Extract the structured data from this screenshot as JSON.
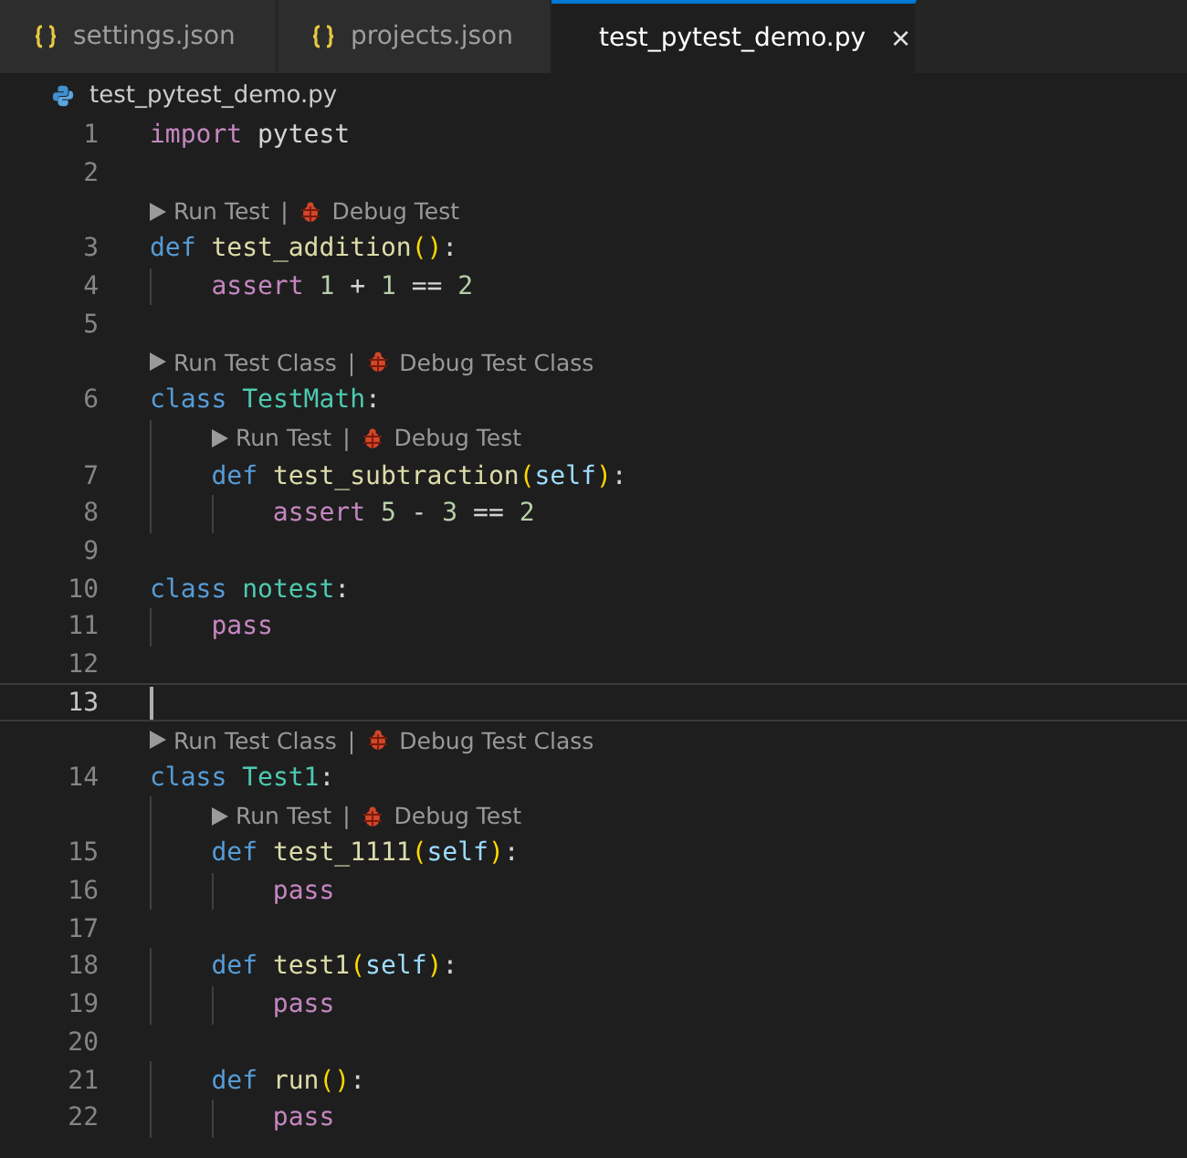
{
  "tabs": [
    {
      "label": "settings.json",
      "kind": "json",
      "selected": false
    },
    {
      "label": "projects.json",
      "kind": "json",
      "selected": false
    },
    {
      "label": "test_pytest_demo.py",
      "kind": "python",
      "selected": true,
      "close": "×"
    }
  ],
  "breadcrumb": {
    "label": "test_pytest_demo.py",
    "kind": "python"
  },
  "lines": [
    {
      "kind": "code",
      "number": "1",
      "tokens": [
        {
          "text": "import",
          "kind": "control"
        },
        {
          "text": " pytest",
          "kind": "plain"
        }
      ]
    },
    {
      "kind": "code",
      "number": "2"
    },
    {
      "kind": "lens",
      "run": "Run Test",
      "sep": "|",
      "debug": "Debug Test"
    },
    {
      "kind": "code",
      "number": "3",
      "tokens": [
        {
          "text": "def",
          "kind": "keyword"
        },
        {
          "text": " test_addition",
          "kind": "function"
        },
        {
          "text": "()",
          "kind": "paren"
        },
        {
          "text": ":",
          "kind": "plain"
        }
      ]
    },
    {
      "kind": "code",
      "number": "4",
      "tokens": [
        {
          "text": "    assert",
          "kind": "control"
        },
        {
          "text": " 1",
          "kind": "number"
        },
        {
          "text": " + ",
          "kind": "plain"
        },
        {
          "text": "1",
          "kind": "number"
        },
        {
          "text": " == ",
          "kind": "plain"
        },
        {
          "text": "2",
          "kind": "number"
        }
      ]
    },
    {
      "kind": "code",
      "number": "5"
    },
    {
      "kind": "lens",
      "run": "Run Test Class",
      "sep": "|",
      "debug": "Debug Test Class"
    },
    {
      "kind": "code",
      "number": "6",
      "tokens": [
        {
          "text": "class",
          "kind": "keyword"
        },
        {
          "text": " TestMath",
          "kind": "class"
        },
        {
          "text": ":",
          "kind": "plain"
        }
      ]
    },
    {
      "kind": "lens",
      "run": "Run Test",
      "sep": "|",
      "debug": "Debug Test"
    },
    {
      "kind": "code",
      "number": "7",
      "tokens": [
        {
          "text": "    def",
          "kind": "keyword"
        },
        {
          "text": " test_subtraction",
          "kind": "function"
        },
        {
          "text": "(",
          "kind": "paren"
        },
        {
          "text": "self",
          "kind": "param"
        },
        {
          "text": ")",
          "kind": "paren"
        },
        {
          "text": ":",
          "kind": "plain"
        }
      ]
    },
    {
      "kind": "code",
      "number": "8",
      "tokens": [
        {
          "text": "        assert",
          "kind": "control"
        },
        {
          "text": " 5",
          "kind": "number"
        },
        {
          "text": " - ",
          "kind": "plain"
        },
        {
          "text": "3",
          "kind": "number"
        },
        {
          "text": " == ",
          "kind": "plain"
        },
        {
          "text": "2",
          "kind": "number"
        }
      ]
    },
    {
      "kind": "code",
      "number": "9"
    },
    {
      "kind": "code",
      "number": "10",
      "tokens": [
        {
          "text": "class",
          "kind": "keyword"
        },
        {
          "text": " notest",
          "kind": "class"
        },
        {
          "text": ":",
          "kind": "plain"
        }
      ]
    },
    {
      "kind": "code",
      "number": "11",
      "tokens": [
        {
          "text": "    pass",
          "kind": "control"
        }
      ]
    },
    {
      "kind": "code",
      "number": "12"
    },
    {
      "kind": "code",
      "number": "13",
      "current": true
    },
    {
      "kind": "lens",
      "run": "Run Test Class",
      "sep": "|",
      "debug": "Debug Test Class"
    },
    {
      "kind": "code",
      "number": "14",
      "tokens": [
        {
          "text": "class",
          "kind": "keyword"
        },
        {
          "text": " Test1",
          "kind": "class"
        },
        {
          "text": ":",
          "kind": "plain"
        }
      ]
    },
    {
      "kind": "lens",
      "run": "Run Test",
      "sep": "|",
      "debug": "Debug Test"
    },
    {
      "kind": "code",
      "number": "15",
      "tokens": [
        {
          "text": "    def",
          "kind": "keyword"
        },
        {
          "text": " test_1111",
          "kind": "function"
        },
        {
          "text": "(",
          "kind": "paren"
        },
        {
          "text": "self",
          "kind": "param"
        },
        {
          "text": ")",
          "kind": "paren"
        },
        {
          "text": ":",
          "kind": "plain"
        }
      ]
    },
    {
      "kind": "code",
      "number": "16",
      "tokens": [
        {
          "text": "        pass",
          "kind": "control"
        }
      ]
    },
    {
      "kind": "code",
      "number": "17"
    },
    {
      "kind": "code",
      "number": "18",
      "tokens": [
        {
          "text": "    def",
          "kind": "keyword"
        },
        {
          "text": " test1",
          "kind": "function"
        },
        {
          "text": "(",
          "kind": "paren"
        },
        {
          "text": "self",
          "kind": "param"
        },
        {
          "text": ")",
          "kind": "paren"
        },
        {
          "text": ":",
          "kind": "plain"
        }
      ]
    },
    {
      "kind": "code",
      "number": "19",
      "tokens": [
        {
          "text": "        pass",
          "kind": "control"
        }
      ]
    },
    {
      "kind": "code",
      "number": "20"
    },
    {
      "kind": "code",
      "number": "21",
      "tokens": [
        {
          "text": "    def",
          "kind": "keyword"
        },
        {
          "text": " run",
          "kind": "function"
        },
        {
          "text": "()",
          "kind": "paren"
        },
        {
          "text": ":",
          "kind": "plain"
        }
      ]
    },
    {
      "kind": "code",
      "number": "22",
      "tokens": [
        {
          "text": "        pass",
          "kind": "control"
        }
      ]
    }
  ]
}
